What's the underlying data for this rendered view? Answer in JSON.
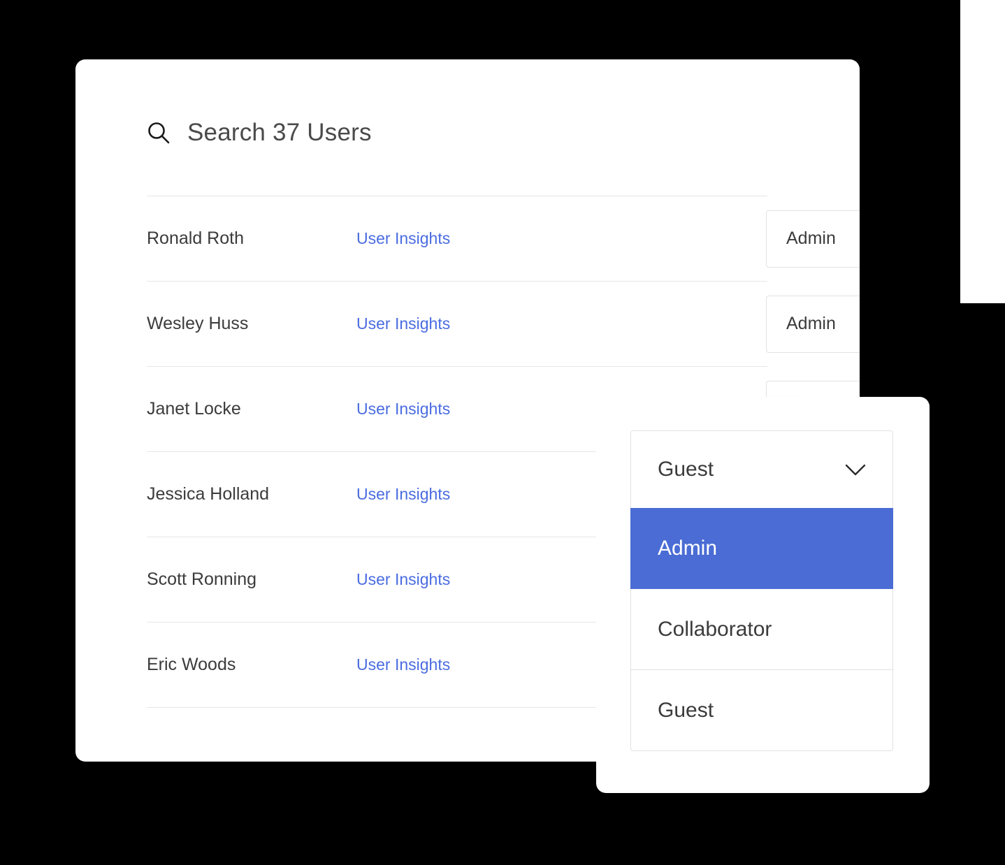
{
  "search": {
    "icon": "search-icon",
    "title": "Search 37 Users",
    "user_count": 37
  },
  "table": {
    "rows": [
      {
        "name": "Ronald Roth",
        "link_label": "User Insights",
        "role": "Admin"
      },
      {
        "name": "Wesley Huss",
        "link_label": "User Insights",
        "role": "Admin"
      },
      {
        "name": "Janet Locke",
        "link_label": "User Insights",
        "role": ""
      },
      {
        "name": "Jessica Holland",
        "link_label": "User Insights",
        "role": ""
      },
      {
        "name": "Scott Ronning",
        "link_label": "User Insights",
        "role": ""
      },
      {
        "name": "Eric Woods",
        "link_label": "User Insights",
        "role": ""
      }
    ]
  },
  "dropdown": {
    "trigger_value": "Guest",
    "chevron_icon": "chevron-down-icon",
    "options": [
      {
        "label": "Admin",
        "selected": true
      },
      {
        "label": "Collaborator",
        "selected": false
      },
      {
        "label": "Guest",
        "selected": false
      }
    ]
  },
  "colors": {
    "accent": "#4a6cd4",
    "link": "#4a6ce0",
    "text": "#3b3b3b",
    "muted_text": "#4a4a4a",
    "border": "#e2e2e2",
    "divider": "#e6e6e6",
    "card_bg": "#ffffff",
    "page_bg": "#000000"
  }
}
